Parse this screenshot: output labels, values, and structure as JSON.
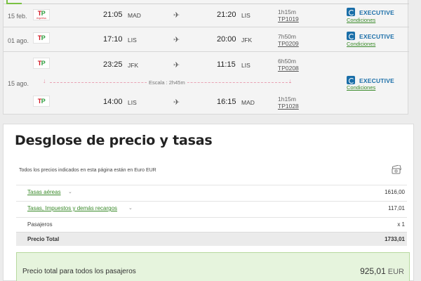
{
  "flights": [
    {
      "date": "15 feb.",
      "segments": [
        {
          "airline_label": "TP",
          "airline_sub": "express",
          "depart_time": "21:05",
          "depart_airport": "MAD",
          "arrive_time": "21:20",
          "arrive_airport": "LIS",
          "duration": "1h15m",
          "flight_number": "TP1019"
        }
      ],
      "fare_class": "EXECUTIVE",
      "conditions_label": "Condiciones"
    },
    {
      "date": "01 ago.",
      "segments": [
        {
          "airline_label": "TP",
          "airline_sub": "",
          "depart_time": "17:10",
          "depart_airport": "LIS",
          "arrive_time": "20:00",
          "arrive_airport": "JFK",
          "duration": "7h50m",
          "flight_number": "TP0209"
        }
      ],
      "fare_class": "EXECUTIVE",
      "conditions_label": "Condiciones"
    },
    {
      "date": "15 ago.",
      "segments": [
        {
          "airline_label": "TP",
          "airline_sub": "",
          "depart_time": "23:25",
          "depart_airport": "JFK",
          "arrive_time": "11:15",
          "arrive_airport": "LIS",
          "duration": "6h50m",
          "flight_number": "TP0208"
        },
        {
          "airline_label": "TP",
          "airline_sub": "",
          "depart_time": "14:00",
          "depart_airport": "LIS",
          "arrive_time": "16:15",
          "arrive_airport": "MAD",
          "duration": "1h15m",
          "flight_number": "TP1028"
        }
      ],
      "stopover_label": "Escala : 2h45m",
      "fare_class": "EXECUTIVE",
      "conditions_label": "Condiciones"
    }
  ],
  "price_breakdown": {
    "title": "Desglose de precio y tasas",
    "currency_note": "Todos los precios indicados en esta página están en Euro EUR",
    "lines": [
      {
        "label": "Tasas aéreas",
        "value": "1616,00",
        "expandable": true
      },
      {
        "label": "Tasas, Impuestos y demás recargos",
        "value": "117,01",
        "expandable": true
      },
      {
        "label": "Pasajeros",
        "value": "x 1",
        "expandable": false
      }
    ],
    "total_label": "Precio Total",
    "total_value": "1733,01",
    "grand_total_label": "Precio total para todos los pasajeros",
    "grand_total_value": "925,01",
    "grand_total_currency": "EUR"
  },
  "icons": {
    "plane": "plane-icon",
    "cash": "cash-icon",
    "chevron": "chevron-down-icon",
    "fare_class": "executive-class-icon"
  },
  "colors": {
    "accent_green": "#3a8a2a",
    "class_blue": "#1a6ea8",
    "tap_red": "#d1131f",
    "tap_green": "#2d9e3e"
  }
}
